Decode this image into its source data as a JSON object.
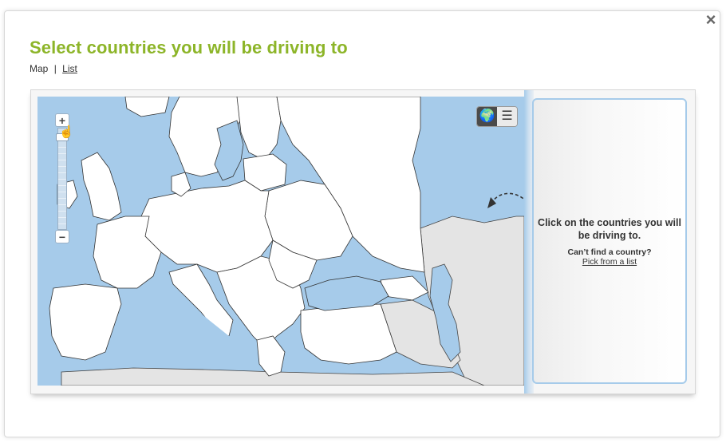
{
  "dialog": {
    "close_icon": "×",
    "title": "Select countries you will be driving to",
    "view_switch": {
      "map_label": "Map",
      "separator": "|",
      "list_label": "List"
    }
  },
  "map": {
    "zoom_in_label": "+",
    "zoom_out_label": "−",
    "toggle": {
      "map_icon": "globe-icon",
      "map_glyph": "🌍",
      "list_icon": "list-icon",
      "list_glyph": "☰"
    },
    "colors": {
      "water": "#a6cbea",
      "selectable_land": "#ffffff",
      "other_land": "#e4e4e4",
      "border": "#333333"
    }
  },
  "side_panel": {
    "instruction": "Click on the countries you will be driving to.",
    "cant_find": "Can’t find a country?",
    "pick_link": "Pick from a list"
  },
  "colors": {
    "title": "#8db529",
    "accent_blue": "#a6cbea"
  }
}
